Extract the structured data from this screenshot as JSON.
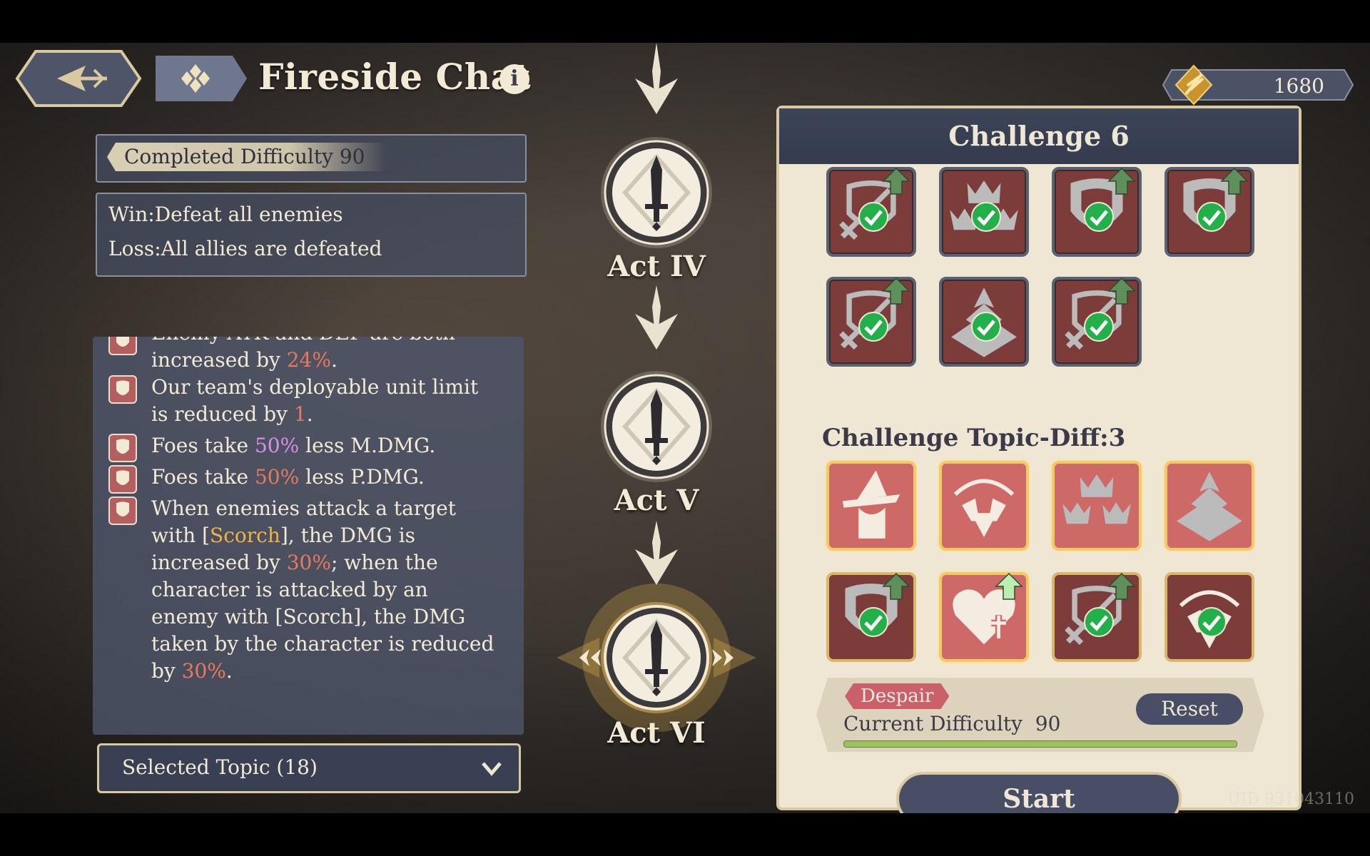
{
  "header": {
    "title": "Fireside Chat",
    "info_icon": "info-icon",
    "back_icon": "back-arrow-icon",
    "menu_icon": "four-diamond-menu-icon"
  },
  "currency": {
    "icon": "quill-feather-icon",
    "value": "1680"
  },
  "left": {
    "completed_label": "Completed Difficulty 90",
    "win": "Win:Defeat all enemies",
    "loss": "Loss:All allies are defeated",
    "effects": [
      {
        "icon": "sword-up-icon",
        "text_before": "increased by ",
        "pct": "24%",
        "text_after": ".",
        "partial_top": "Enemy ATK and DEF are both"
      },
      {
        "icon": "crowns-icon",
        "line1": "Our team's deployable unit limit",
        "line2_before": "is reduced by ",
        "num": "1",
        "line2_after": "."
      },
      {
        "icon": "shield-up-icon",
        "before": "Foes take ",
        "pct": "50%",
        "after": " less M.DMG."
      },
      {
        "icon": "shield-up-icon",
        "before": "Foes take ",
        "pct": "50%",
        "after": " less P.DMG."
      },
      {
        "icon": "sword-up-icon",
        "l1": "When enemies attack a target",
        "l2a": "with [",
        "kw": "Scorch",
        "l2b": "], the DMG is",
        "l3a": "increased by ",
        "pct1": "30%",
        "l3b": "; when the",
        "l4": "character is attacked by an",
        "l5": "enemy with [Scorch], the DMG",
        "l6": "taken by the character is reduced",
        "l7a": "by ",
        "pct2": "30%",
        "l7b": "."
      }
    ],
    "selected_topic": "Selected Topic (18)"
  },
  "acts": [
    {
      "label": "Act IV"
    },
    {
      "label": "Act V"
    },
    {
      "label": "Act VI"
    }
  ],
  "panel": {
    "title": "Challenge 6",
    "topic_heading": "Challenge Topic-Diff:3",
    "despair": "Despair",
    "current_difficulty_label": "Current Difficulty",
    "current_difficulty_value": "90",
    "difficulty_progress": 1.0,
    "reset": "Reset",
    "start": "Start"
  },
  "selected_tiles": [
    {
      "icon": "sword-shield-icon",
      "checked": true,
      "upgrade": true
    },
    {
      "icon": "crowns-icon",
      "checked": true,
      "upgrade": false
    },
    {
      "icon": "shield-icon",
      "checked": true,
      "upgrade": true
    },
    {
      "icon": "shield-icon",
      "checked": true,
      "upgrade": true
    },
    {
      "icon": "sword-shield-icon",
      "checked": true,
      "upgrade": true
    },
    {
      "icon": "diamond-arrow-icon",
      "checked": true,
      "upgrade": false
    },
    {
      "icon": "sword-shield-icon",
      "checked": true,
      "upgrade": true
    }
  ],
  "topic_tiles": [
    {
      "icon": "witch-hat-icon",
      "checked": false,
      "upgrade": false,
      "state": "available"
    },
    {
      "icon": "halo-fist-icon",
      "checked": false,
      "upgrade": false,
      "state": "available"
    },
    {
      "icon": "crowns-icon",
      "checked": false,
      "upgrade": false,
      "state": "available"
    },
    {
      "icon": "diamond-arrow-icon",
      "checked": false,
      "upgrade": false,
      "state": "available"
    },
    {
      "icon": "shield-icon",
      "checked": true,
      "upgrade": true,
      "state": "selected"
    },
    {
      "icon": "heart-plus-icon",
      "checked": false,
      "upgrade": true,
      "state": "available"
    },
    {
      "icon": "sword-shield-icon",
      "checked": true,
      "upgrade": true,
      "state": "selected"
    },
    {
      "icon": "halo-fist-icon",
      "checked": true,
      "upgrade": false,
      "state": "selected"
    }
  ],
  "uid": "UID 931043110",
  "colors": {
    "accent_gold": "#d9c9a0",
    "panel_bg": "#efe7d4",
    "tile_red": "#cd6a68",
    "check_green": "#23b04a"
  }
}
